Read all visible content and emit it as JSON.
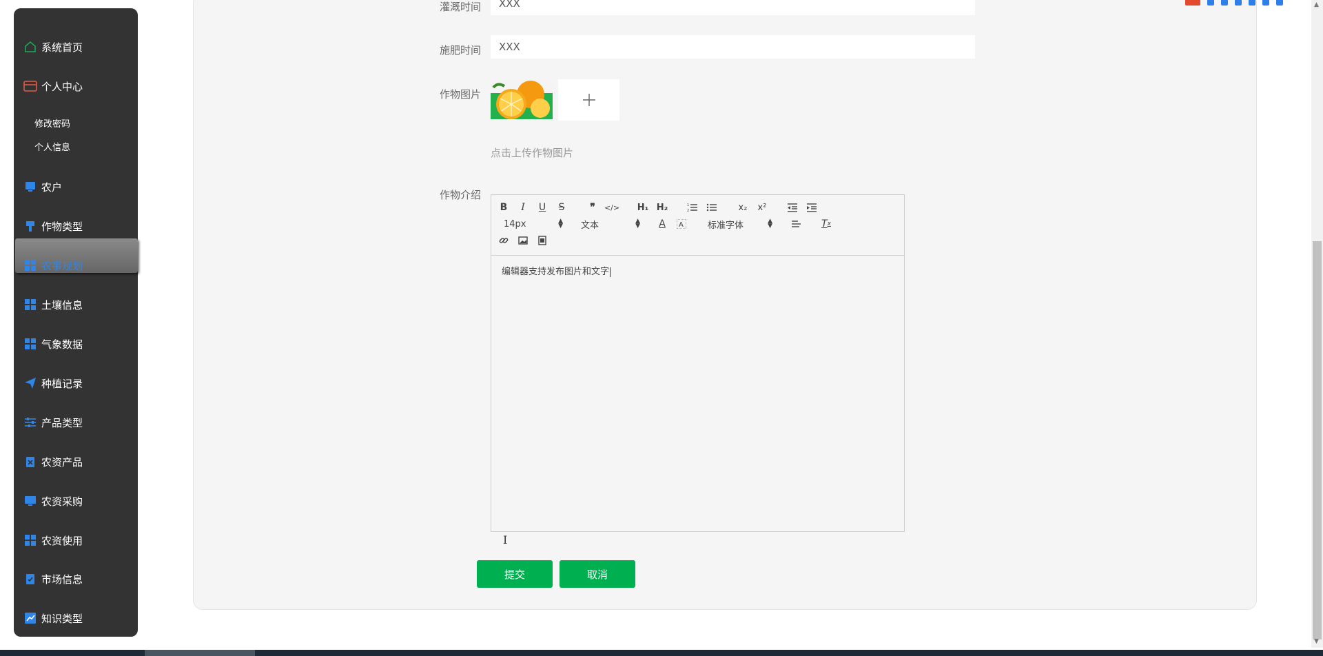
{
  "sidebar": {
    "items": [
      {
        "label": "系统首页",
        "icon": "home-icon",
        "color": "#1aa85a"
      },
      {
        "label": "个人中心",
        "icon": "wallet-icon",
        "color": "#e65a45"
      },
      {
        "label": "农户",
        "icon": "monitor-icon",
        "color": "#2f86e8"
      },
      {
        "label": "作物类型",
        "icon": "pin-icon",
        "color": "#2f86e8"
      },
      {
        "label": "农事规划",
        "icon": "grid-icon",
        "color": "#2f86e8"
      },
      {
        "label": "土壤信息",
        "icon": "grid-icon",
        "color": "#2f86e8"
      },
      {
        "label": "气象数据",
        "icon": "grid-icon",
        "color": "#2f86e8"
      },
      {
        "label": "种植记录",
        "icon": "send-icon",
        "color": "#2f86e8"
      },
      {
        "label": "产品类型",
        "icon": "sliders-icon",
        "color": "#2f86e8"
      },
      {
        "label": "农资产品",
        "icon": "clipboard-x-icon",
        "color": "#2f86e8"
      },
      {
        "label": "农资采购",
        "icon": "monitor-icon",
        "color": "#2f86e8"
      },
      {
        "label": "农资使用",
        "icon": "grid-icon",
        "color": "#2f86e8"
      },
      {
        "label": "市场信息",
        "icon": "clipboard-check-icon",
        "color": "#2f86e8"
      },
      {
        "label": "知识类型",
        "icon": "chart-icon",
        "color": "#2f86e8"
      }
    ],
    "sub_items": [
      "修改密码",
      "个人信息"
    ],
    "active_index": 4
  },
  "form": {
    "irrigation": {
      "label": "灌溉时间",
      "value": "XXX"
    },
    "fertilize": {
      "label": "施肥时间",
      "value": "XXX"
    },
    "image": {
      "label": "作物图片",
      "hint": "点击上传作物图片"
    },
    "intro": {
      "label": "作物介绍"
    }
  },
  "editor": {
    "font_size": "14px",
    "block_type": "文本",
    "font_family": "标准字体",
    "content": "编辑器支持发布图片和文字"
  },
  "buttons": {
    "submit": "提交",
    "cancel": "取消"
  },
  "colors": {
    "accent": "#00b050",
    "sidebar_bg": "#333333",
    "nav_icon": "#2f86e8"
  }
}
